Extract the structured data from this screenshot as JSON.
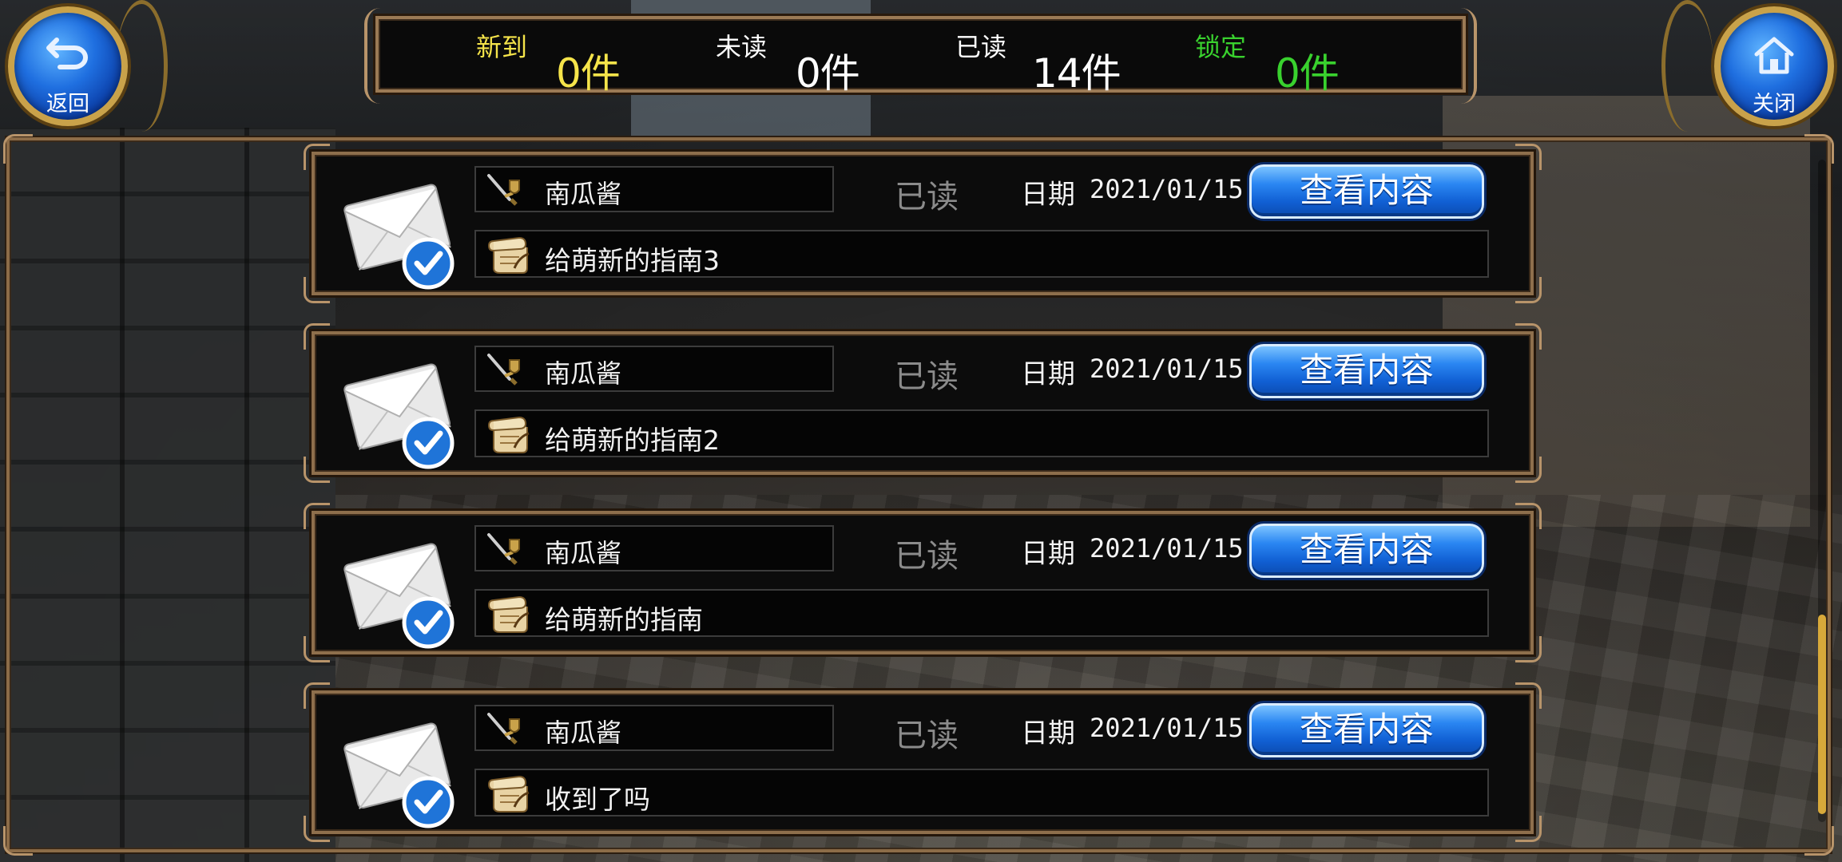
{
  "stats": [
    {
      "label": "新到",
      "value": "0件",
      "label_color": "#f5e44a",
      "value_color": "#f5e44a"
    },
    {
      "label": "未读",
      "value": "0件",
      "label_color": "#ffffff",
      "value_color": "#ffffff"
    },
    {
      "label": "已读",
      "value": "14件",
      "label_color": "#ffffff",
      "value_color": "#ffffff"
    },
    {
      "label": "锁定",
      "value": "0件",
      "label_color": "#39d12e",
      "value_color": "#39d12e"
    }
  ],
  "nav": {
    "back_label": "返回",
    "back_icon": "back-arrow-icon",
    "close_label": "关闭",
    "close_icon": "home-icon"
  },
  "mails": [
    {
      "sender": "南瓜酱",
      "status": "已读",
      "date_label": "日期",
      "date": "2021/01/15",
      "button": "查看内容",
      "subject": "给萌新的指南3"
    },
    {
      "sender": "南瓜酱",
      "status": "已读",
      "date_label": "日期",
      "date": "2021/01/15",
      "button": "查看内容",
      "subject": "给萌新的指南2"
    },
    {
      "sender": "南瓜酱",
      "status": "已读",
      "date_label": "日期",
      "date": "2021/01/15",
      "button": "查看内容",
      "subject": "给萌新的指南"
    },
    {
      "sender": "南瓜酱",
      "status": "已读",
      "date_label": "日期",
      "date": "2021/01/15",
      "button": "查看内容",
      "subject": "收到了吗"
    }
  ],
  "colors": {
    "frame": "#8e6f4c",
    "button_blue": "#1160d4",
    "read_status": "#8b8b8b",
    "scroll_thumb": "#d8a93a"
  }
}
